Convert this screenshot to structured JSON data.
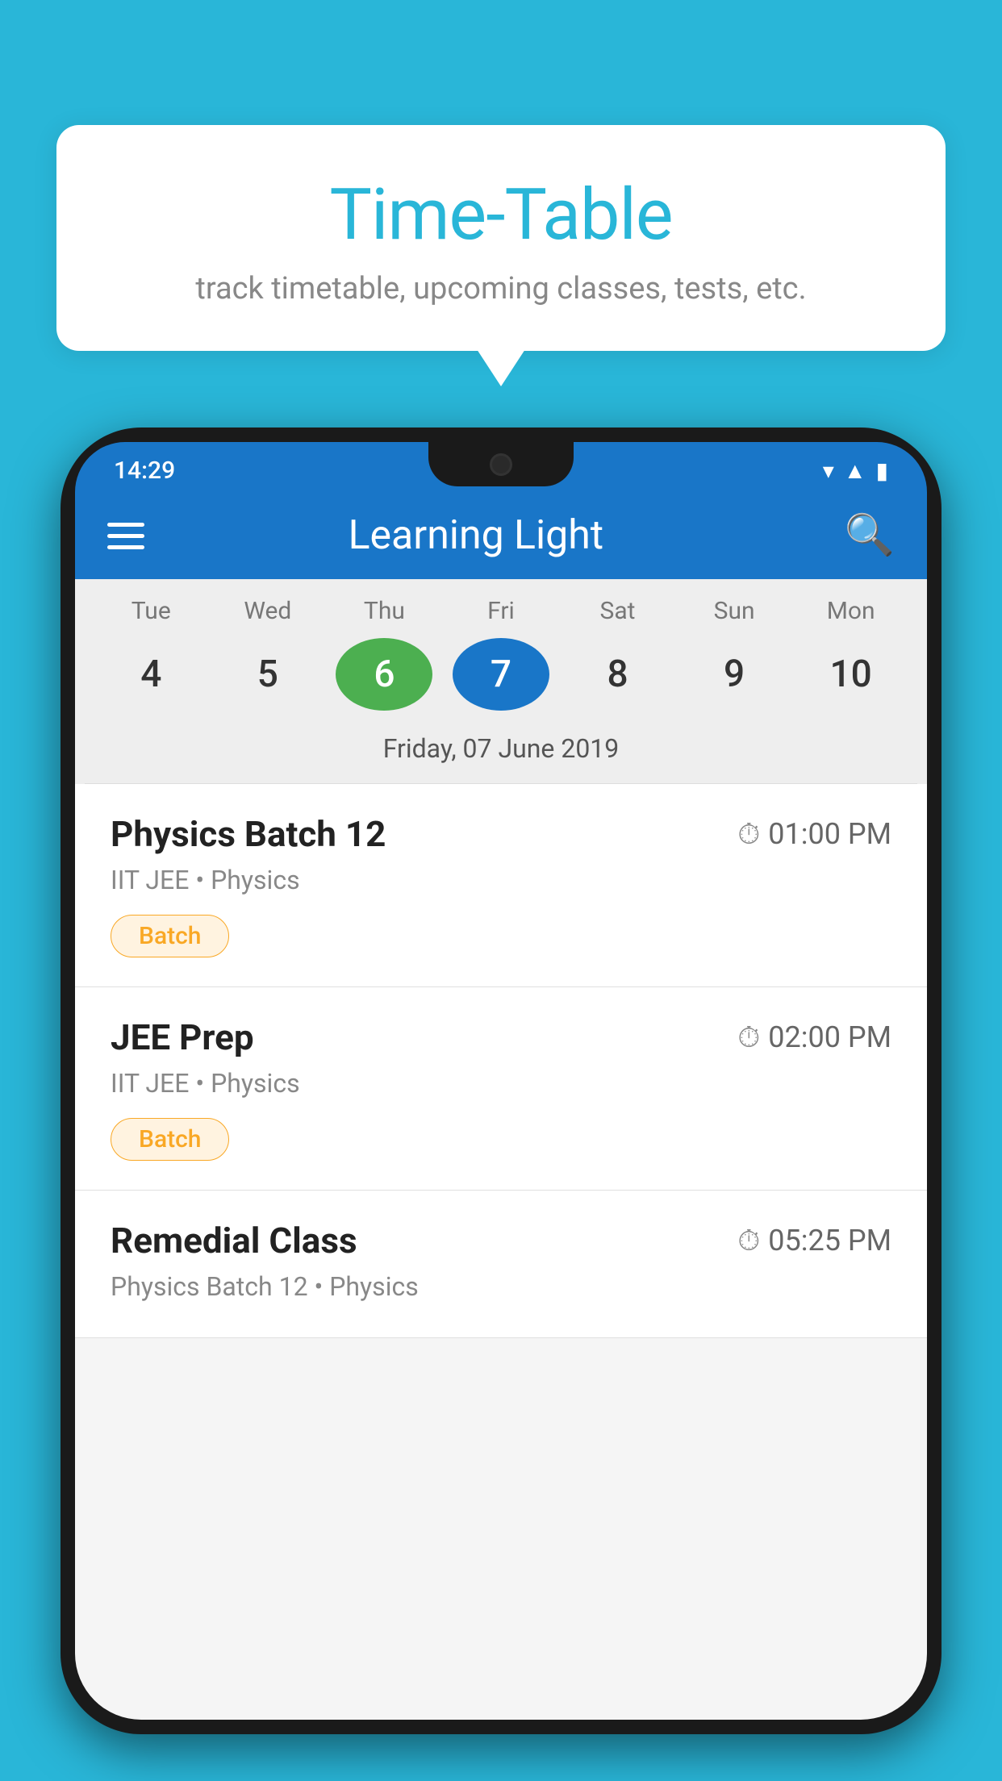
{
  "background_color": "#29B6D8",
  "tooltip": {
    "title": "Time-Table",
    "subtitle": "track timetable, upcoming classes, tests, etc."
  },
  "phone": {
    "status_bar": {
      "time": "14:29"
    },
    "app_bar": {
      "title": "Learning Light"
    },
    "calendar": {
      "days": [
        {
          "label": "Tue",
          "num": "4"
        },
        {
          "label": "Wed",
          "num": "5"
        },
        {
          "label": "Thu",
          "num": "6",
          "state": "today"
        },
        {
          "label": "Fri",
          "num": "7",
          "state": "selected"
        },
        {
          "label": "Sat",
          "num": "8"
        },
        {
          "label": "Sun",
          "num": "9"
        },
        {
          "label": "Mon",
          "num": "10"
        }
      ],
      "selected_date_label": "Friday, 07 June 2019"
    },
    "classes": [
      {
        "name": "Physics Batch 12",
        "time": "01:00 PM",
        "subject": "IIT JEE • Physics",
        "tag": "Batch"
      },
      {
        "name": "JEE Prep",
        "time": "02:00 PM",
        "subject": "IIT JEE • Physics",
        "tag": "Batch"
      },
      {
        "name": "Remedial Class",
        "time": "05:25 PM",
        "subject": "Physics Batch 12 • Physics",
        "tag": null
      }
    ]
  }
}
